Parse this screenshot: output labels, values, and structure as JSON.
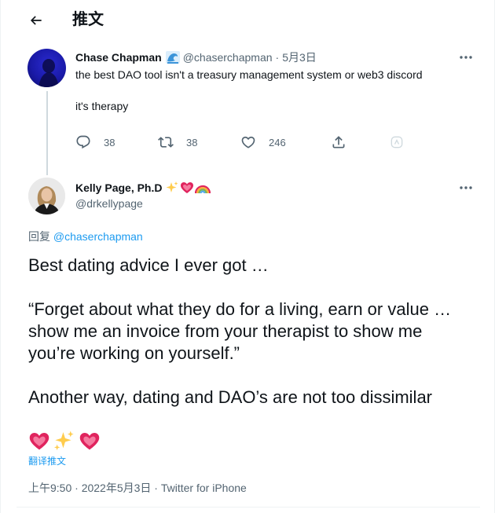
{
  "header": {
    "title": "推文"
  },
  "tweet1": {
    "display_name": "Chase Chapman",
    "handle": "@chaserchapman",
    "separator": "·",
    "date": "5月3日",
    "text_line1": "the best DAO tool isn't a treasury management system or web3 discord",
    "text_line2": "it's therapy",
    "actions": {
      "replies": "38",
      "retweets": "38",
      "likes": "246"
    }
  },
  "tweet2": {
    "display_name": "Kelly Page, Ph.D",
    "handle": "@drkellypage",
    "replying_prefix": "回复",
    "replying_to": "@chaserchapman",
    "body": [
      "Best dating advice I ever got …",
      "“Forget about what they do for a living, earn or value …",
      "show me an invoice from your therapist to show me",
      "you’re working on yourself.”",
      "Another way, dating and DAO’s are not too dissimilar"
    ],
    "translate_label": "翻译推文",
    "time": "上午9:50 · 2022年5月3日",
    "source_separator": "·",
    "source": "Twitter for iPhone"
  },
  "colors": {
    "accent": "#1d9bf0",
    "secondary_text": "#536471",
    "primary_text": "#0f1419",
    "heart": "#e0245e",
    "sparkle": "#ffcc4d"
  },
  "icons": [
    "back-arrow-icon",
    "wave-icon",
    "more-icon",
    "reply-icon",
    "retweet-icon",
    "like-icon",
    "share-icon",
    "analytics-icon",
    "sparkles-emoji",
    "heart-emoji",
    "rainbow-emoji"
  ]
}
